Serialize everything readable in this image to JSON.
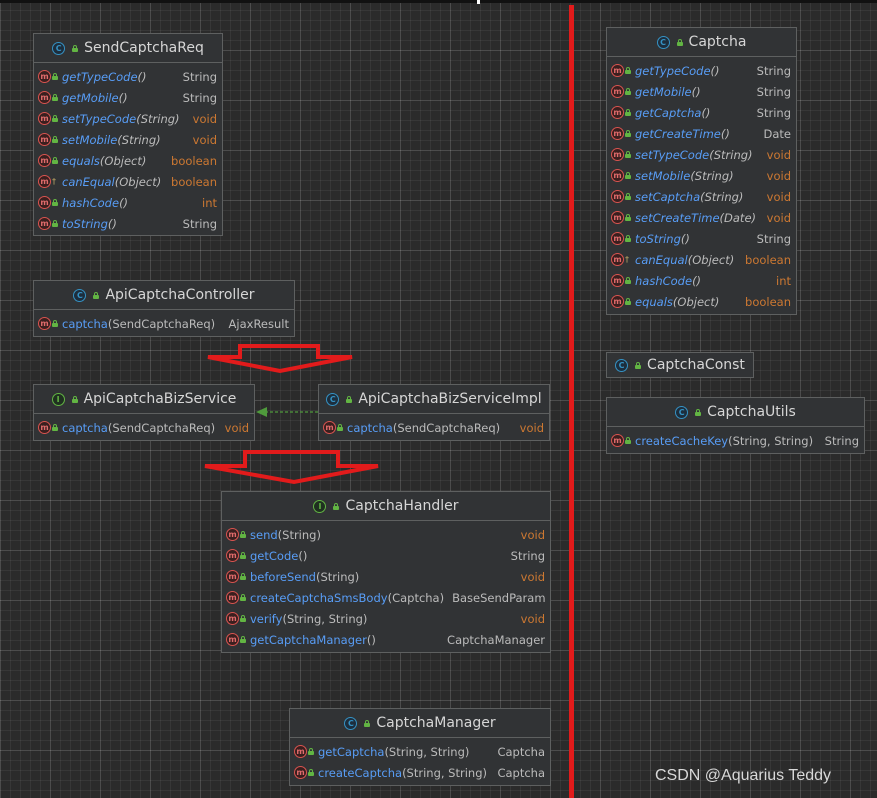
{
  "classes": {
    "send_captcha_req": {
      "name": "SendCaptchaReq",
      "methods": [
        {
          "name": "getTypeCode",
          "params": "()",
          "type": "String"
        },
        {
          "name": "getMobile",
          "params": "()",
          "type": "String"
        },
        {
          "name": "setTypeCode",
          "params": "(String)",
          "type": "void"
        },
        {
          "name": "setMobile",
          "params": "(String)",
          "type": "void"
        },
        {
          "name": "equals",
          "params": "(Object)",
          "type": "boolean"
        },
        {
          "name": "canEqual",
          "params": "(Object)",
          "type": "boolean"
        },
        {
          "name": "hashCode",
          "params": "()",
          "type": "int"
        },
        {
          "name": "toString",
          "params": "()",
          "type": "String"
        }
      ]
    },
    "api_captcha_controller": {
      "name": "ApiCaptchaController",
      "methods": [
        {
          "name": "captcha",
          "params": "(SendCaptchaReq)",
          "type": "AjaxResult"
        }
      ]
    },
    "api_captcha_biz_service": {
      "name": "ApiCaptchaBizService",
      "methods": [
        {
          "name": "captcha",
          "params": "(SendCaptchaReq)",
          "type": "void"
        }
      ]
    },
    "api_captcha_biz_service_impl": {
      "name": "ApiCaptchaBizServiceImpl",
      "methods": [
        {
          "name": "captcha",
          "params": "(SendCaptchaReq)",
          "type": "void"
        }
      ]
    },
    "captcha_handler": {
      "name": "CaptchaHandler",
      "methods": [
        {
          "name": "send",
          "params": "(String)",
          "type": "void"
        },
        {
          "name": "getCode",
          "params": "()",
          "type": "String"
        },
        {
          "name": "beforeSend",
          "params": " (String)",
          "type": "void"
        },
        {
          "name": "createCaptchaSmsBody",
          "params": "(Captcha)",
          "type": "BaseSendParam"
        },
        {
          "name": "verify",
          "params": "(String, String)",
          "type": "void"
        },
        {
          "name": "getCaptchaManager",
          "params": "()",
          "type": "CaptchaManager"
        }
      ]
    },
    "captcha_manager": {
      "name": "CaptchaManager",
      "methods": [
        {
          "name": "getCaptcha",
          "params": "(String, String)",
          "type": "Captcha"
        },
        {
          "name": "createCaptcha",
          "params": "(String, String)",
          "type": "Captcha"
        }
      ]
    },
    "captcha": {
      "name": "Captcha",
      "methods": [
        {
          "name": "getTypeCode",
          "params": "()",
          "type": "String"
        },
        {
          "name": "getMobile",
          "params": "()",
          "type": "String"
        },
        {
          "name": "getCaptcha",
          "params": "()",
          "type": "String"
        },
        {
          "name": "getCreateTime",
          "params": "()",
          "type": "Date"
        },
        {
          "name": "setTypeCode",
          "params": "(String)",
          "type": "void"
        },
        {
          "name": "setMobile",
          "params": "(String)",
          "type": "void"
        },
        {
          "name": "setCaptcha",
          "params": "(String)",
          "type": "void"
        },
        {
          "name": "setCreateTime",
          "params": "(Date)",
          "type": "void"
        },
        {
          "name": "toString",
          "params": "()",
          "type": "String"
        },
        {
          "name": "canEqual",
          "params": "(Object)",
          "type": "boolean"
        },
        {
          "name": "hashCode",
          "params": "()",
          "type": "int"
        },
        {
          "name": "equals",
          "params": "(Object)",
          "type": "boolean"
        }
      ]
    },
    "captcha_const": {
      "name": "CaptchaConst",
      "methods": []
    },
    "captcha_utils": {
      "name": "CaptchaUtils",
      "methods": [
        {
          "name": "createCacheKey",
          "params": "(String, String)",
          "type": "String"
        }
      ]
    }
  },
  "watermark": "CSDN @Aquarius Teddy",
  "colors": {
    "background": "#2b2b2b",
    "box": "#313335",
    "border": "#5e6060",
    "method_name": "#589df6",
    "type_keyword": "#cc7832",
    "type_plain": "#bbbbbb",
    "highlight_red": "#e21b1b",
    "implements_arrow": "#4f9a3c"
  }
}
